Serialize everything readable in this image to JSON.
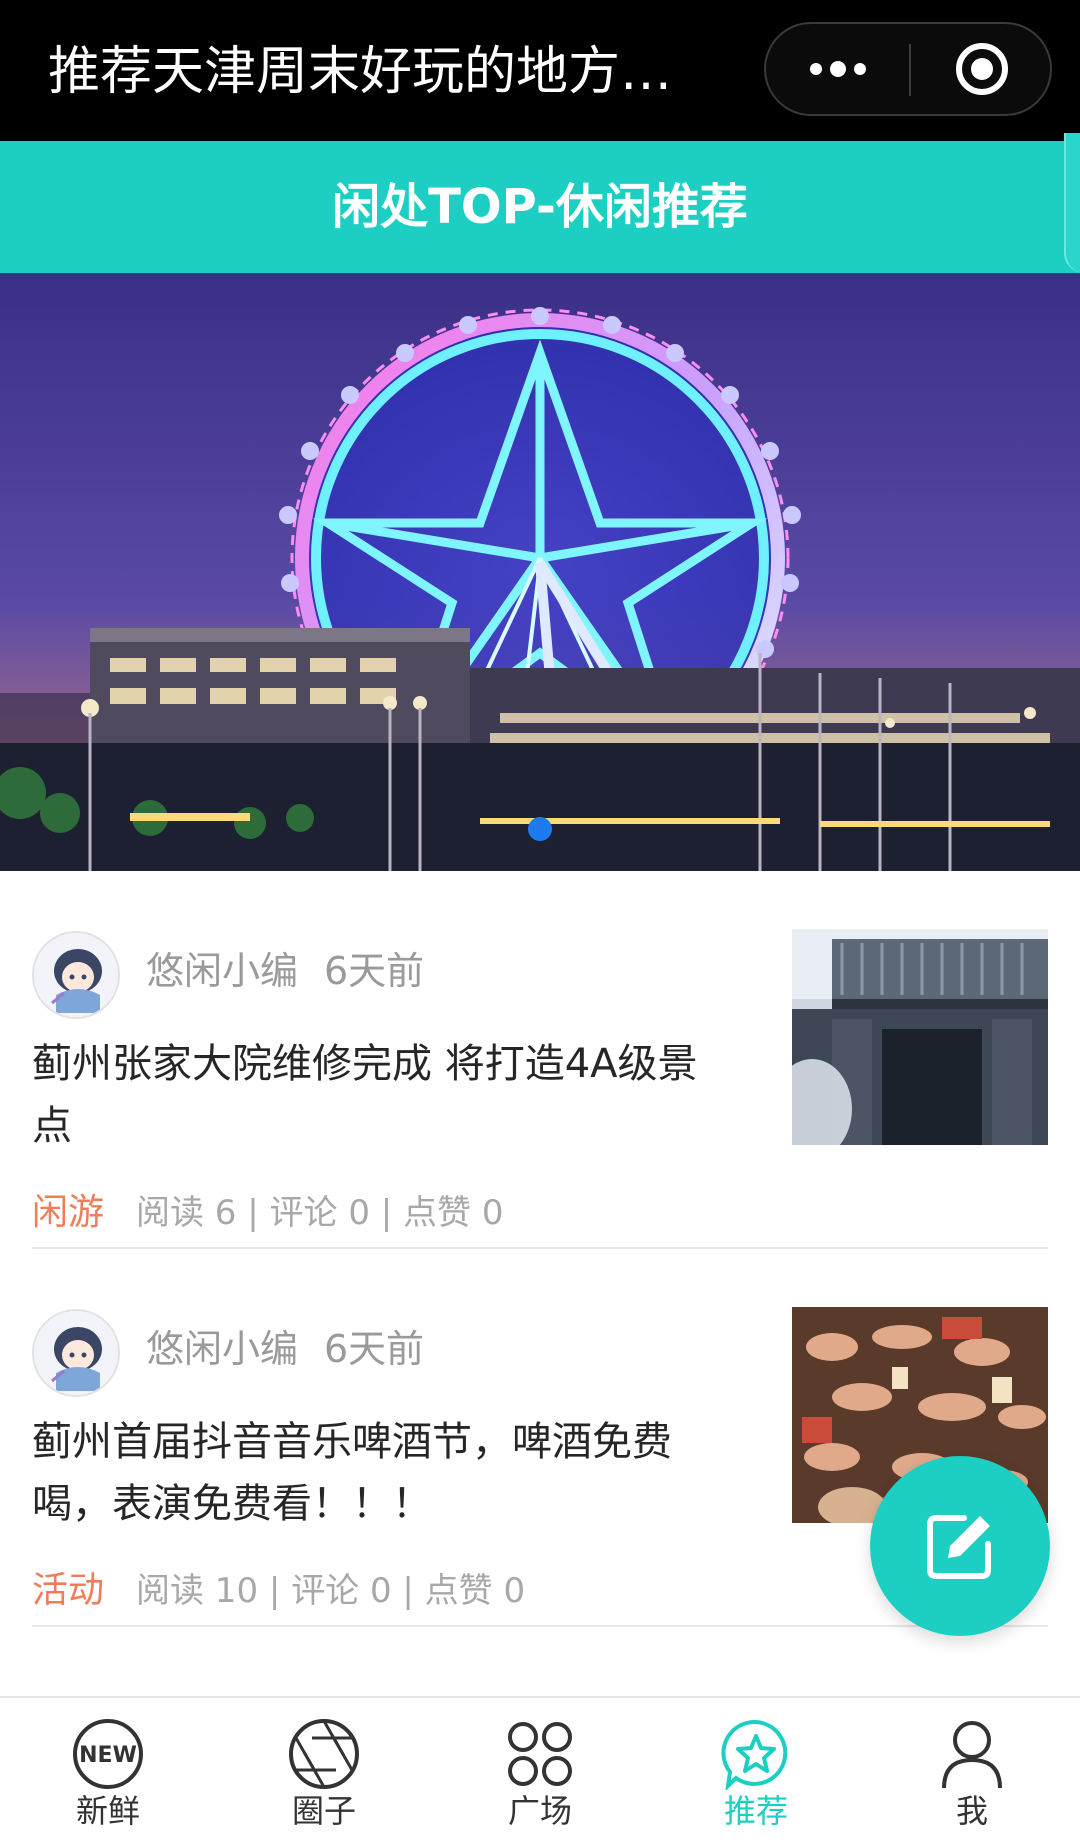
{
  "window": {
    "title": "推荐天津周末好玩的地方…",
    "more_icon": "more-dots-icon",
    "close_icon": "target-close-icon"
  },
  "header": {
    "title": "闲处TOP-休闲推荐"
  },
  "banner": {
    "image": "ferris-wheel-night-photo",
    "active_slide": 1,
    "slide_count": 1
  },
  "feed": [
    {
      "author": "悠闲小编",
      "time": "6天前",
      "title": "蓟州张家大院维修完成 将打造4A级景点",
      "tag": "闲游",
      "stats": "阅读 6 | 评论 0 | 点赞 0",
      "thumb": "traditional-courtyard-gate-photo"
    },
    {
      "author": "悠闲小编",
      "time": "6天前",
      "title": "蓟州首届抖音音乐啤酒节，啤酒免费喝，表演免费看！！！",
      "tag": "活动",
      "stats": "阅读 10 | 评论 0 | 点赞 0",
      "thumb": "beer-festival-crowd-photo"
    }
  ],
  "fab": {
    "icon": "edit-icon"
  },
  "tabbar": {
    "tabs": [
      {
        "label": "新鲜",
        "icon": "new-badge-icon"
      },
      {
        "label": "圈子",
        "icon": "aperture-icon"
      },
      {
        "label": "广场",
        "icon": "grid-circles-icon"
      },
      {
        "label": "推荐",
        "icon": "star-chat-icon"
      },
      {
        "label": "我",
        "icon": "person-icon"
      }
    ],
    "active_index": 3
  },
  "colors": {
    "accent": "#1dcfc3",
    "tag": "#f07d5a",
    "meta": "#9a9a9a",
    "dot": "#1e7bef"
  }
}
